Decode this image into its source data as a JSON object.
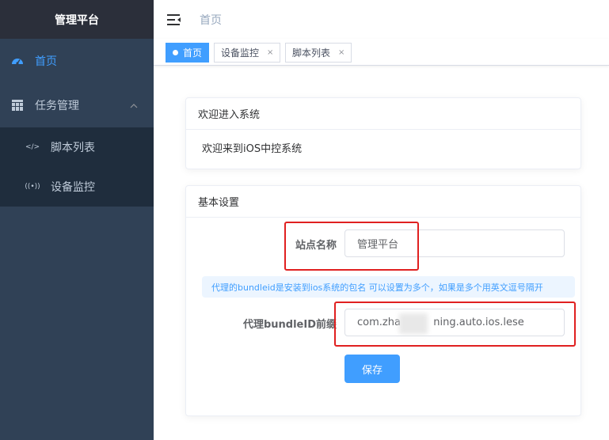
{
  "sidebar": {
    "logo": "管理平台",
    "items": [
      {
        "label": "首页",
        "icon": "dashboard-icon",
        "active": true
      },
      {
        "label": "任务管理",
        "icon": "table-grid-icon",
        "expanded": true,
        "children": [
          {
            "label": "脚本列表",
            "icon": "code-icon"
          },
          {
            "label": "设备监控",
            "icon": "broadcast-icon"
          }
        ]
      }
    ]
  },
  "navbar": {
    "breadcrumb": "首页"
  },
  "tags": [
    {
      "label": "首页",
      "active": true
    },
    {
      "label": "设备监控",
      "close": "×"
    },
    {
      "label": "脚本列表",
      "close": "×"
    }
  ],
  "welcome": {
    "header": "欢迎进入系统",
    "text": "欢迎来到iOS中控系统"
  },
  "settings": {
    "header": "基本设置",
    "site_name_label": "站点名称",
    "site_name_value": "管理平台",
    "hint": "代理的bundleid是安装到ios系统的包名 可以设置为多个，如果是多个用英文逗号隔开",
    "bundle_label": "代理bundleID前缀",
    "bundle_value": "com.zha          ning.auto.ios.lese",
    "save_label": "保存"
  },
  "colors": {
    "accent": "#409eff",
    "sidebar": "#304156",
    "highlight": "#e02020"
  }
}
